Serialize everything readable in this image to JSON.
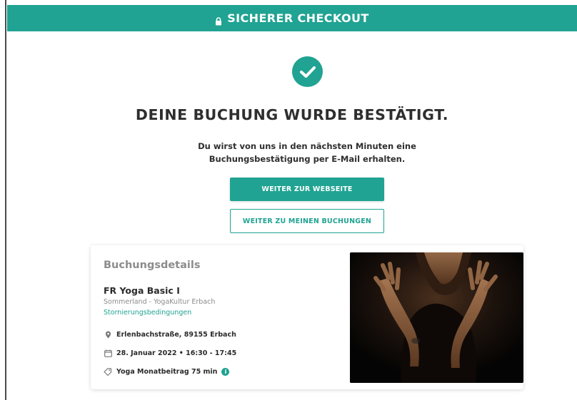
{
  "header": {
    "title": "SICHERER CHECKOUT",
    "lock_icon": "lock-icon"
  },
  "confirmation": {
    "check_icon": "check-circle-icon",
    "title": "DEINE BUCHUNG WURDE BESTÄTIGT.",
    "message_line1": "Du wirst von uns in den nächsten Minuten eine",
    "message_line2": "Buchungsbestätigung per E-Mail erhalten."
  },
  "actions": {
    "website_label": "WEITER ZUR WEBSEITE",
    "bookings_label": "WEITER ZU MEINEN BUCHUNGEN"
  },
  "booking": {
    "heading": "Buchungsdetails",
    "course_name": "FR Yoga Basic I",
    "location": "Sommerland - YogaKultur Erbach",
    "cancellation_link": "Stornierungsbedingungen",
    "address": "Erlenbachstraße, 89155 Erbach",
    "datetime": "28. Januar 2022 • 16:30 - 17:45",
    "tariff": "Yoga Monatbeitrag 75 min",
    "info_symbol": "i",
    "photo_alt": "Yoga-Teilnehmerin mit erhobenen Händen"
  },
  "colors": {
    "accent": "#20a392",
    "text": "#2b2b2b",
    "muted": "#8c8c8c"
  }
}
